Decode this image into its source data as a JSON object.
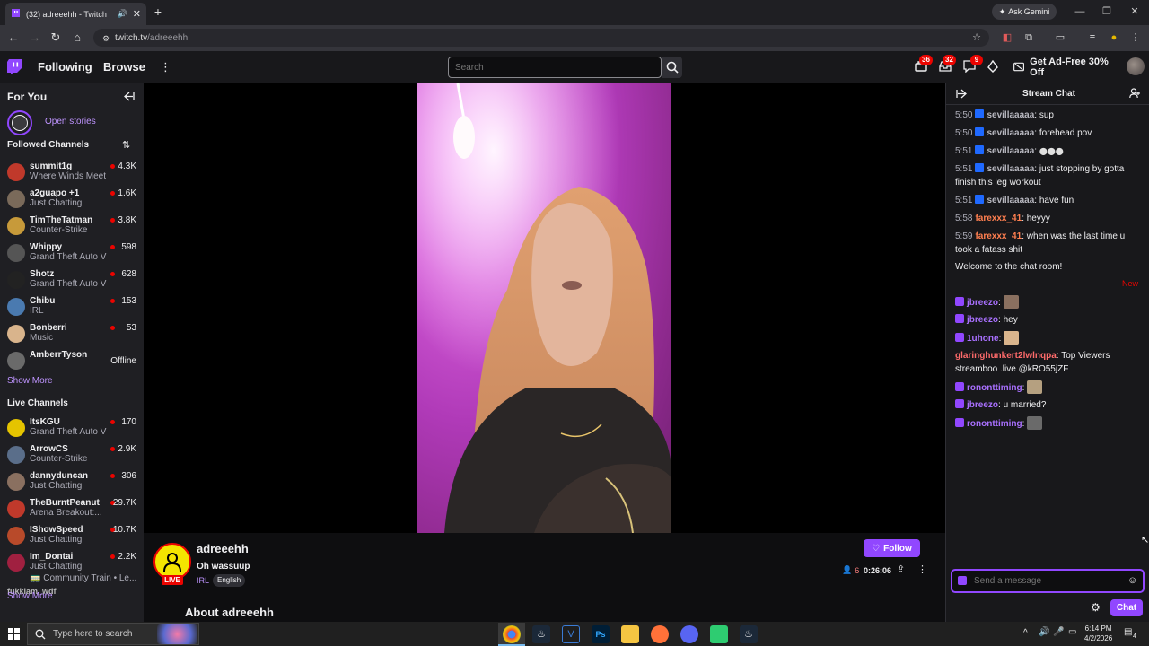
{
  "browser": {
    "tab_title": "(32) adreeehh - Twitch",
    "url_host": "twitch.tv",
    "url_path": "/adreeehh",
    "gemini_label": "Ask Gemini"
  },
  "topnav": {
    "following_label": "Following",
    "browse_label": "Browse",
    "search_placeholder": "Search",
    "badges": {
      "notifications": "36",
      "inbox": "32",
      "whispers": "9"
    },
    "adfree_label": "Get Ad-Free 30% Off"
  },
  "sidebar": {
    "for_you_label": "For You",
    "open_stories_label": "Open stories",
    "followed_label": "Followed Channels",
    "followed": [
      {
        "name": "summit1g",
        "game": "Where Winds Meet",
        "viewers": "4.3K",
        "color": "#c0392b"
      },
      {
        "name": "a2guapo +1",
        "game": "Just Chatting",
        "viewers": "1.6K",
        "color": "#7a6a5a"
      },
      {
        "name": "TimTheTatman",
        "game": "Counter-Strike",
        "viewers": "3.8K",
        "color": "#c79a3a"
      },
      {
        "name": "Whippy",
        "game": "Grand Theft Auto V",
        "viewers": "598",
        "color": "#555"
      },
      {
        "name": "Shotz",
        "game": "Grand Theft Auto V",
        "viewers": "628",
        "color": "#222"
      },
      {
        "name": "Chibu",
        "game": "IRL",
        "viewers": "153",
        "color": "#4a7ab0"
      },
      {
        "name": "Bonberri",
        "game": "Music",
        "viewers": "53",
        "color": "#d9b48c"
      },
      {
        "name": "AmberrTyson",
        "game": "",
        "viewers": "Offline",
        "color": "#6a6a6a"
      }
    ],
    "show_more_label": "Show More",
    "live_label": "Live Channels",
    "live": [
      {
        "name": "ItsKGU",
        "game": "Grand Theft Auto V",
        "viewers": "170",
        "color": "#e5c400"
      },
      {
        "name": "ArrowCS",
        "game": "Counter-Strike",
        "viewers": "2.9K",
        "color": "#5a6e8a"
      },
      {
        "name": "dannyduncan",
        "game": "Just Chatting",
        "viewers": "306",
        "color": "#8a7060"
      },
      {
        "name": "TheBurntPeanut",
        "game": "Arena Breakout:...",
        "viewers": "29.7K",
        "color": "#c0392b"
      },
      {
        "name": "IShowSpeed",
        "game": "Just Chatting",
        "viewers": "10.7K",
        "color": "#b84a2a"
      },
      {
        "name": "Im_Dontai",
        "game": "Just Chatting",
        "viewers": "2.2K",
        "color": "#a02040"
      }
    ],
    "community_train_label": "Community Train • Le...",
    "overlap_label": "fukkiam_wdf",
    "show_more_label_2": "Show More"
  },
  "stream": {
    "channel": "adreeehh",
    "title": "Oh wassuup",
    "category": "IRL",
    "language": "English",
    "live_label": "LIVE",
    "follow_label": "Follow",
    "viewers": "6",
    "uptime": "0:26:06",
    "about_label": "About adreeehh"
  },
  "chat": {
    "title": "Stream Chat",
    "messages": [
      {
        "time": "5:50",
        "user": "sevillaaaaa",
        "text": "sup",
        "color": "#b8b8c0"
      },
      {
        "time": "5:50",
        "user": "sevillaaaaa",
        "text": "forehead pov",
        "color": "#b8b8c0"
      },
      {
        "time": "5:51",
        "user": "sevillaaaaa",
        "text": "",
        "color": "#b8b8c0"
      },
      {
        "time": "5:51",
        "user": "sevillaaaaa",
        "text": "just stopping by gotta finish this leg workout",
        "color": "#b8b8c0"
      },
      {
        "time": "5:51",
        "user": "sevillaaaaa",
        "text": "have fun",
        "color": "#b8b8c0"
      },
      {
        "time": "5:58",
        "user": "farexxx_41",
        "text": "heyyy",
        "color": "#ff7f50"
      },
      {
        "time": "5:59",
        "user": "farexxx_41",
        "text": "when was the last time u took a fatass shit",
        "color": "#ff7f50"
      }
    ],
    "welcome": "Welcome to the chat room!",
    "new_label": "New",
    "messages2": [
      {
        "user": "jbreezo",
        "text": "",
        "color": "#a970ff"
      },
      {
        "user": "jbreezo",
        "text": "hey",
        "color": "#a970ff"
      },
      {
        "user": "1uhone",
        "text": "",
        "color": "#a970ff"
      },
      {
        "user": "glaringhunkert2lwlnqpa",
        "text": "Top Viewers streamboo .live @kRO55jZF",
        "color": "#ff6b6b"
      },
      {
        "user": "rononttiming",
        "text": "",
        "color": "#a970ff"
      },
      {
        "user": "jbreezo",
        "text": "u married?",
        "color": "#a970ff"
      },
      {
        "user": "rononttiming",
        "text": "",
        "color": "#a970ff"
      }
    ],
    "input_placeholder": "Send a message",
    "chat_button": "Chat"
  },
  "taskbar": {
    "search_placeholder": "Type here to search",
    "time": "6:14 PM",
    "date": "4/2/2026",
    "notif_count": "4"
  }
}
